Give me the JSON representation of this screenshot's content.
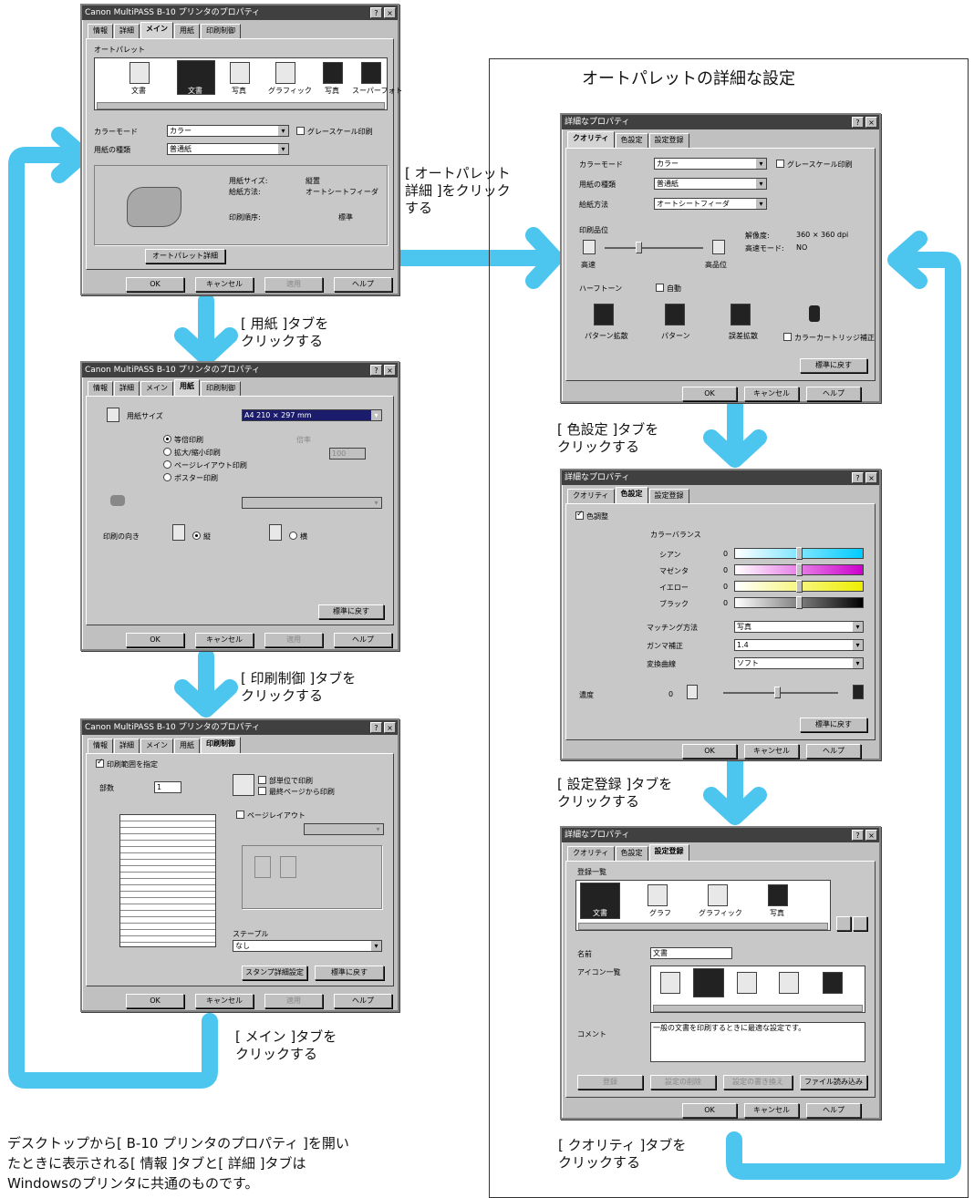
{
  "right_panel": {
    "title": "オートパレットの詳細な設定"
  },
  "captions": {
    "auto_palette": "[ オートパレット\n詳細 ]をクリック\nする",
    "paper_tab": "[ 用紙 ]タブを\nクリックする",
    "print_control_tab": "[ 印刷制御 ]タブを\nクリックする",
    "main_tab": "[ メイン ]タブを\nクリックする",
    "color_settings_tab": "[ 色設定 ]タブを\nクリックする",
    "register_tab": "[ 設定登録 ]タブを\nクリックする",
    "quality_tab": "[ クオリティ ]タブを\nクリックする"
  },
  "footnote": "デスクトップから[ B-10 プリンタのプロパティ ]を開い\nたときに表示される[ 情報 ]タブと[ 詳細 ]タブは\nWindowsのプリンタに共通のものです。",
  "dialog_common": {
    "title": "Canon MultiPASS B-10 プリンタのプロパティ",
    "tabs": [
      "情報",
      "詳細",
      "メイン",
      "用紙",
      "印刷制御"
    ],
    "ok": "OK",
    "cancel": "キャンセル",
    "apply": "適用",
    "help": "ヘルプ",
    "restore": "標準に戻す"
  },
  "main_dialog": {
    "auto_palette_label": "オートパレット",
    "icons": [
      "文書",
      "文書",
      "写真",
      "グラフィック",
      "写真",
      "スーパーフォト"
    ],
    "color_mode_label": "カラーモード",
    "color_mode_value": "カラー",
    "grayscale": "グレースケール印刷",
    "media_label": "用紙の種類",
    "media_value": "普通紙",
    "info_size": "用紙サイズ:",
    "info_size_val": "縦置",
    "info_method": "給紙方法:",
    "info_method_val": "オートシートフィーダ",
    "info_sched": "印刷順序:",
    "info_sched_val": "標準",
    "auto_detail_button": "オートパレット詳細"
  },
  "paper_dialog": {
    "size_label": "用紙サイズ",
    "size_value": "A4 210 × 297 mm",
    "opt1": "等倍印刷",
    "opt2": "拡大/縮小印刷",
    "opt3": "ページレイアウト印刷",
    "opt4": "ポスター印刷",
    "scale_label": "倍率",
    "scale_value": "100",
    "orient_label": "印刷の向き",
    "portrait": "縦",
    "landscape": "横"
  },
  "control_dialog": {
    "chk_top": "印刷範囲を指定",
    "copies_label": "部数",
    "copies_value": "1",
    "collate": "部単位で印刷",
    "reverse": "最終ページから印刷",
    "layout_chk": "ページレイアウト",
    "dropdown_label": "ステープル",
    "dropdown_value": "なし",
    "detail_button": "スタンプ詳細設定"
  },
  "quality_dialog": {
    "title": "詳細なプロパティ",
    "tabs": [
      "クオリティ",
      "色設定",
      "設定登録"
    ],
    "color_mode": "カラーモード",
    "color_mode_value": "カラー",
    "grayscale": "グレースケール印刷",
    "media": "用紙の種類",
    "media_value": "普通紙",
    "feed": "給紙方法",
    "feed_value": "オートシートフィーダ",
    "quality_label": "印刷品位",
    "resolution": "解像度:",
    "resolution_value": "360 × 360 dpi",
    "fast_mode": "高速モード:",
    "fast_mode_value": "NO",
    "fast": "高速",
    "fine": "高品位",
    "dither": "ハーフトーン",
    "auto": "自動",
    "pattern1": "パターン拡散",
    "pattern2": "パターン",
    "error_diff": "誤差拡散",
    "cartridge": "カラーカートリッジ補正"
  },
  "color_dialog": {
    "title": "詳細なプロパティ",
    "manual": "色調整",
    "balance": "カラーバランス",
    "cyan": "シアン",
    "magenta": "マゼンタ",
    "yellow": "イエロー",
    "black": "ブラック",
    "zero": "0",
    "matching": "マッチング方法",
    "matching_value": "写真",
    "gamma": "ガンマ補正",
    "gamma_value": "1.4",
    "conversion": "変換曲線",
    "conversion_value": "ソフト",
    "density": "濃度"
  },
  "register_dialog": {
    "title": "詳細なプロパティ",
    "list_label": "登録一覧",
    "list_items": [
      "文書",
      "グラフ",
      "グラフィック",
      "写真"
    ],
    "name_label": "名前",
    "name_value": "文書",
    "icon_label": "アイコン一覧",
    "comment_label": "コメント",
    "comment_value": "一般の文書を印刷するときに最適な設定です。",
    "btn_register": "登録",
    "btn_delete": "設定の削除",
    "btn_restore": "設定の書き換え",
    "btn_file": "ファイル読み込み"
  },
  "colors": {
    "arrow": "#4cc6ef"
  }
}
